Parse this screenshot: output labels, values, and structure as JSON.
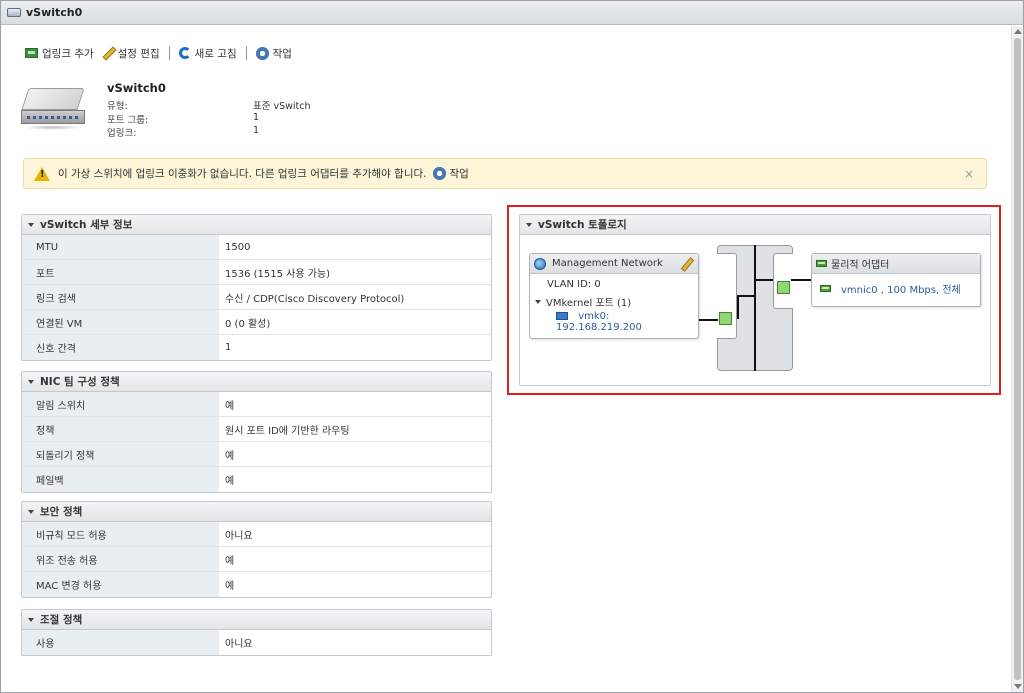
{
  "window": {
    "title": "vSwitch0"
  },
  "toolbar": {
    "add_uplink": "업링크 추가",
    "edit_settings": "설정 편집",
    "refresh": "새로 고침",
    "actions": "작업"
  },
  "summary": {
    "name": "vSwitch0",
    "rows": [
      {
        "key": "유형:",
        "value": "표준 vSwitch"
      },
      {
        "key": "포트 그룹:",
        "value": "1"
      },
      {
        "key": "업링크:",
        "value": "1"
      }
    ]
  },
  "alert": {
    "text": "이 가상 스위치에 업링크 이중화가 없습니다. 다른 업링크 어댑터를 추가해야 합니다.",
    "action": "작업",
    "close": "×"
  },
  "panels": {
    "details": {
      "title": "vSwitch 세부 정보",
      "rows": [
        {
          "key": "MTU",
          "value": "1500"
        },
        {
          "key": "포트",
          "value": "1536 (1515 사용 가능)"
        },
        {
          "key": "링크 검색",
          "value": "수신 / CDP(Cisco Discovery Protocol)"
        },
        {
          "key": "연결된 VM",
          "value": "0 (0 활성)"
        },
        {
          "key": "신호 간격",
          "value": "1"
        }
      ]
    },
    "nic_teaming": {
      "title": "NIC 팀 구성 정책",
      "rows": [
        {
          "key": "알림 스위치",
          "value": "예"
        },
        {
          "key": "정책",
          "value": "원시 포트 ID에 기반한 라우팅"
        },
        {
          "key": "되돌리기 정책",
          "value": "예"
        },
        {
          "key": "페일백",
          "value": "예"
        }
      ]
    },
    "security": {
      "title": "보안 정책",
      "rows": [
        {
          "key": "비규칙 모드 허용",
          "value": "아니요"
        },
        {
          "key": "위조 전송 허용",
          "value": "예"
        },
        {
          "key": "MAC 변경 허용",
          "value": "예"
        }
      ]
    },
    "shaping": {
      "title": "조절 정책",
      "rows": [
        {
          "key": "사용",
          "value": "아니요"
        }
      ]
    }
  },
  "topology": {
    "title": "vSwitch 토폴로지",
    "portgroup": {
      "name": "Management Network",
      "vlan": "VLAN ID: 0",
      "vmkernel": "VMkernel 포트 (1)",
      "vmk": "vmk0: 192.168.219.200"
    },
    "physical": {
      "title": "물리적 어댑터",
      "nic": "vmnic0 , 100 Mbps, 전체"
    }
  }
}
